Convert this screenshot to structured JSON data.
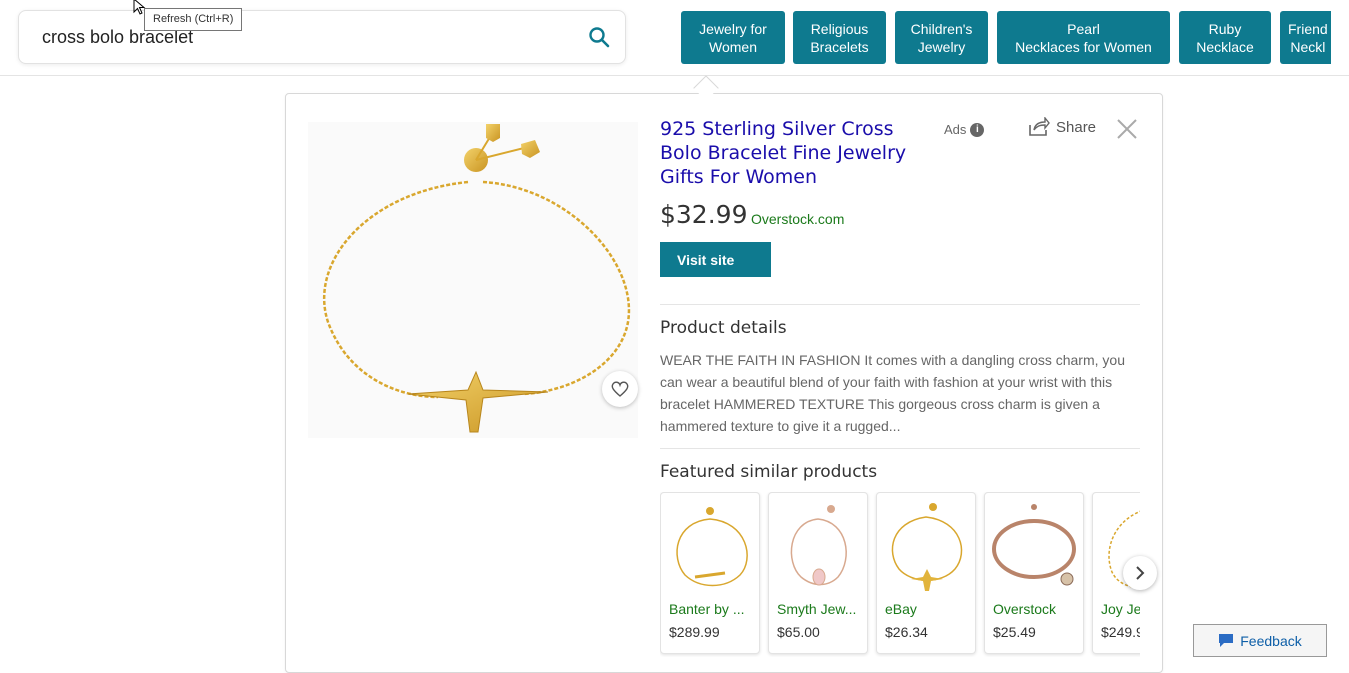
{
  "search": {
    "query": "cross bolo bracelet"
  },
  "tooltip": {
    "text": "Refresh (Ctrl+R)"
  },
  "chips": [
    {
      "line1": "Jewelry for",
      "line2": "Women"
    },
    {
      "line1": "Religious",
      "line2": "Bracelets"
    },
    {
      "line1": "Children's",
      "line2": "Jewelry"
    },
    {
      "line1": "Pearl",
      "line2": "Necklaces for Women"
    },
    {
      "line1": "Ruby",
      "line2": "Necklace"
    },
    {
      "line1": "Friend",
      "line2": "Neckl"
    }
  ],
  "product": {
    "title": "925 Sterling Silver Cross Bolo Bracelet Fine Jewelry Gifts For Women",
    "price": "$32.99",
    "merchant": "Overstock.com",
    "visit_label": "Visit site",
    "ads_label": "Ads",
    "share_label": "Share",
    "details_heading": "Product details",
    "description": "WEAR THE FAITH IN FASHION It comes with a dangling cross charm, you can wear a beautiful blend of your faith with fashion at your wrist with this bracelet HAMMERED TEXTURE This gorgeous cross charm is given a hammered texture to give it a rugged..."
  },
  "similar": {
    "heading": "Featured similar products",
    "items": [
      {
        "store": "Banter by ...",
        "price": "$289.99"
      },
      {
        "store": "Smyth Jew...",
        "price": "$65.00"
      },
      {
        "store": "eBay",
        "price": "$26.34"
      },
      {
        "store": "Overstock",
        "price": "$25.49"
      },
      {
        "store": "Joy Je",
        "price": "$249.9"
      }
    ]
  },
  "feedback": {
    "label": "Feedback"
  },
  "colors": {
    "accent": "#0e7a8f",
    "link": "#1a0dab",
    "merchant": "#1b7a1b",
    "gold": "#e2b43c"
  }
}
